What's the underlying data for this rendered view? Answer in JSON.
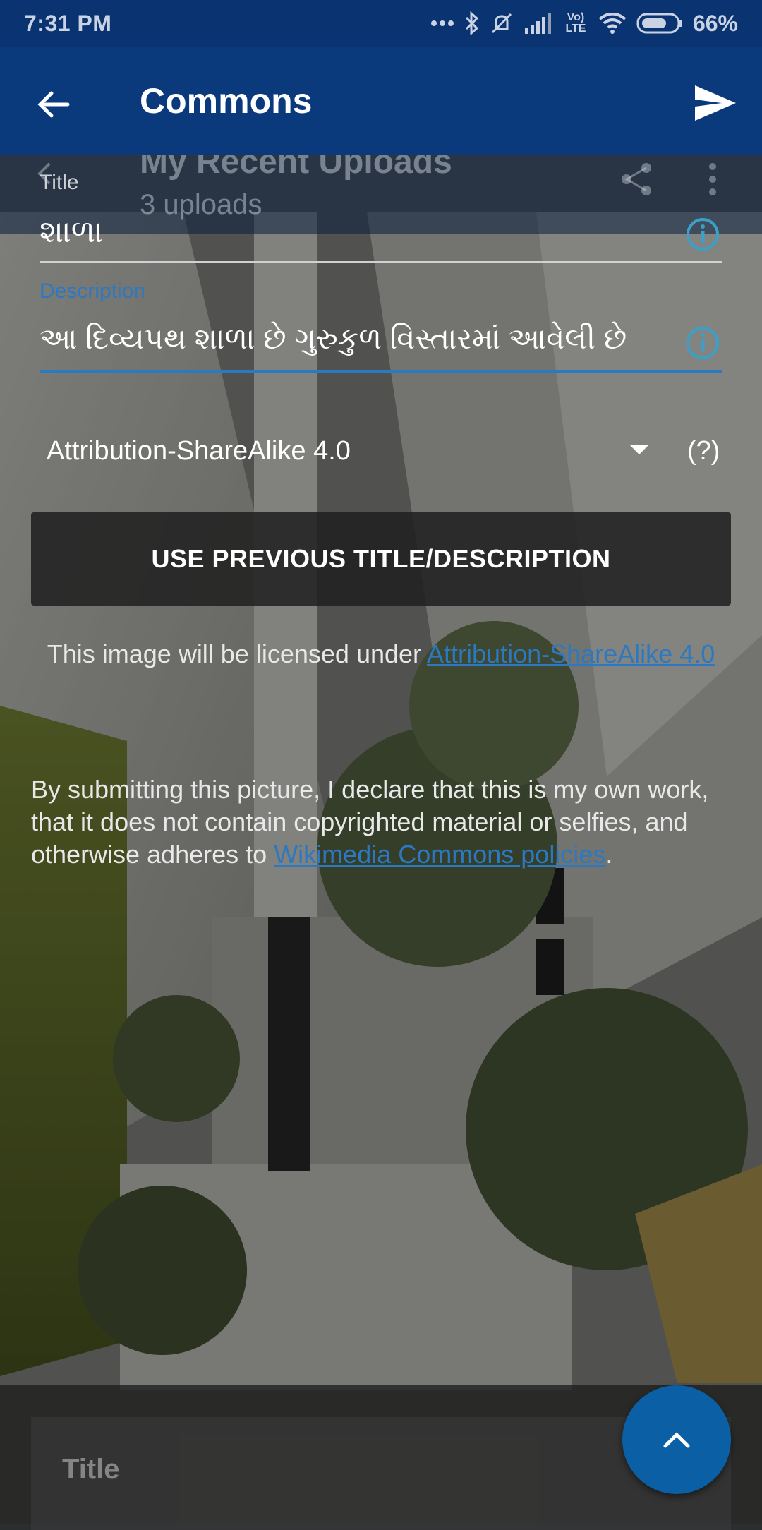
{
  "status_bar": {
    "time": "7:31 PM",
    "battery": "66%",
    "network_label": "Vo) LTE"
  },
  "app_bar": {
    "title": "Commons"
  },
  "background_header": {
    "title": "My Recent Uploads",
    "subtitle": "3 uploads"
  },
  "form": {
    "title_label": "Title",
    "title_value": "શાળા",
    "description_label": "Description",
    "description_value": "આ દિવ્યપથ શાળા છે ગુરુકુળ વિસ્તારમાં આવેલી છે",
    "license_selected": "Attribution-ShareAlike 4.0",
    "license_help": "(?)",
    "previous_button": "USE PREVIOUS TITLE/DESCRIPTION",
    "license_notice_prefix": "This image will be licensed under ",
    "license_notice_link": "Attribution-ShareAlike 4.0",
    "declaration_prefix": "By submitting this picture, I declare that this is my own work, that it does not contain copyrighted material or selfies, and otherwise adheres to ",
    "declaration_link": "Wikimedia Commons policies",
    "declaration_suffix": "."
  },
  "bottom": {
    "title_label": "Title"
  },
  "colors": {
    "status_bar": "#0a3371",
    "app_bar": "#0b3a7c",
    "accent_blue": "#2b79c2",
    "info_icon": "#3aa0c8",
    "fab": "#0b60a5"
  },
  "icons": {
    "back": "back-arrow-icon",
    "send": "send-icon",
    "info": "info-icon",
    "dropdown": "dropdown-triangle-icon",
    "fab": "chevron-up-icon",
    "share": "share-icon",
    "more": "more-vert-icon"
  }
}
